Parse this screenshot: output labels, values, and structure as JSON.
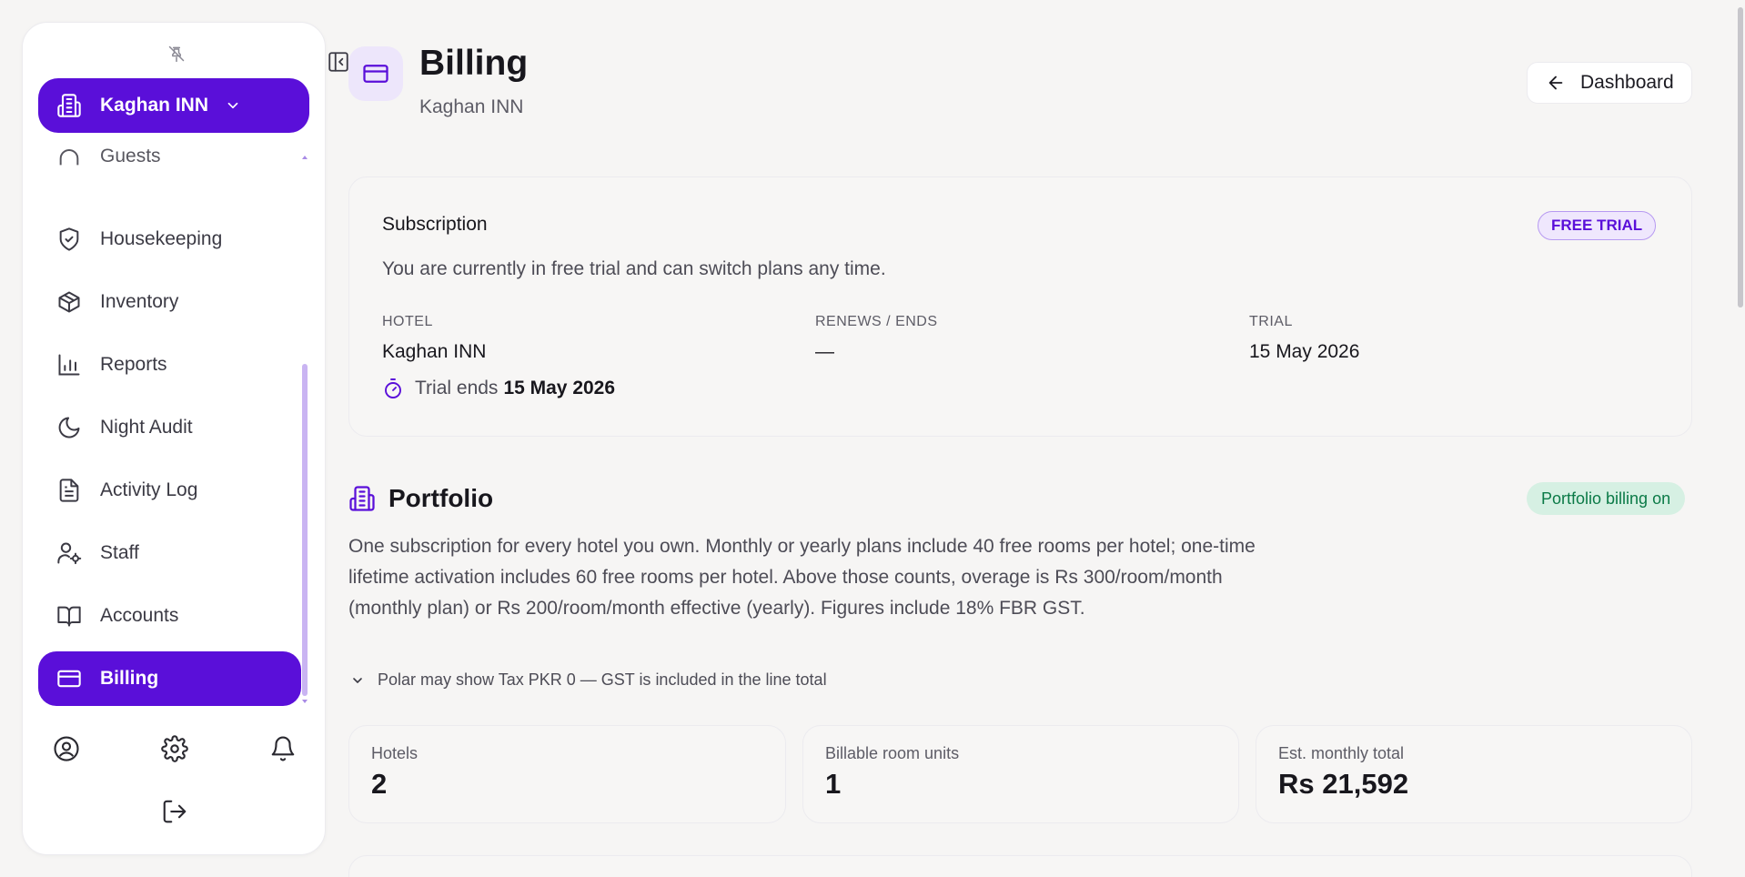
{
  "sidebar": {
    "hotel_switcher": {
      "label": "Kaghan INN"
    },
    "nav": [
      {
        "id": "guests",
        "label": "Guests",
        "icon": "guests-icon"
      },
      {
        "id": "housekeeping",
        "label": "Housekeeping",
        "icon": "shield-check-icon"
      },
      {
        "id": "inventory",
        "label": "Inventory",
        "icon": "box-icon"
      },
      {
        "id": "reports",
        "label": "Reports",
        "icon": "bar-chart-icon"
      },
      {
        "id": "night-audit",
        "label": "Night Audit",
        "icon": "moon-icon"
      },
      {
        "id": "activity-log",
        "label": "Activity Log",
        "icon": "document-icon"
      },
      {
        "id": "staff",
        "label": "Staff",
        "icon": "user-cog-icon"
      },
      {
        "id": "accounts",
        "label": "Accounts",
        "icon": "book-icon"
      },
      {
        "id": "billing",
        "label": "Billing",
        "icon": "credit-card-icon",
        "active": true
      }
    ]
  },
  "header": {
    "title": "Billing",
    "subtitle": "Kaghan INN",
    "dashboard_button": "Dashboard"
  },
  "subscription": {
    "title": "Subscription",
    "badge": "FREE TRIAL",
    "description": "You are currently in free trial and can switch plans any time.",
    "columns": [
      {
        "heading": "HOTEL",
        "value": "Kaghan INN"
      },
      {
        "heading": "RENEWS / ENDS",
        "value": "—"
      },
      {
        "heading": "TRIAL",
        "value": "15 May 2026"
      }
    ],
    "trial_ends_label": "Trial ends",
    "trial_ends_date": "15 May 2026"
  },
  "portfolio": {
    "title": "Portfolio",
    "badge": "Portfolio billing on",
    "description": "One subscription for every hotel you own. Monthly or yearly plans include 40 free rooms per hotel; one-time lifetime activation includes 60 free rooms per hotel. Above those counts, overage is Rs 300/room/month (monthly plan) or Rs 200/room/month effective (yearly). Figures include 18% FBR GST.",
    "note": "Polar may show Tax PKR 0 — GST is included in the line total",
    "stats": [
      {
        "label": "Hotels",
        "value": "2"
      },
      {
        "label": "Billable room units",
        "value": "1"
      },
      {
        "label": "Est. monthly total",
        "value": "Rs 21,592"
      }
    ]
  },
  "colors": {
    "accent": "#5a0fd9",
    "accent_soft": "#ede6fb",
    "success_bg": "#d6f0e3",
    "success_text": "#0b7a47"
  }
}
